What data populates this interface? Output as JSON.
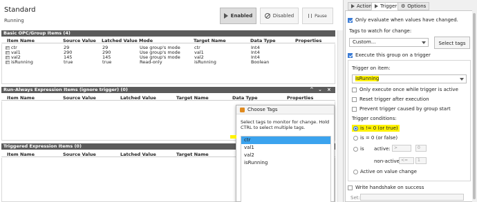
{
  "header": {
    "title": "Standard",
    "status": "Running",
    "enabled_label": "Enabled",
    "disabled_label": "Disabled",
    "pause_label": "Pause"
  },
  "columns": {
    "item_name": "Item Name",
    "source_value": "Source Value",
    "latched_value": "Latched Value",
    "mode": "Mode",
    "target_name": "Target Name",
    "data_type": "Data Type",
    "properties": "Properties"
  },
  "basic_section": {
    "title": "Basic OPC/Group Items (4)",
    "rows": [
      {
        "name": "ctr",
        "source": "29",
        "latched": "29",
        "mode": "Use group's mode",
        "target": "ctr",
        "type": "Int4"
      },
      {
        "name": "val1",
        "source": "290",
        "latched": "290",
        "mode": "Use group's mode",
        "target": "val1",
        "type": "Int4"
      },
      {
        "name": "val2",
        "source": "145",
        "latched": "145",
        "mode": "Use group's mode",
        "target": "val2",
        "type": "Int4"
      },
      {
        "name": "isRunning",
        "source": "true",
        "latched": "true",
        "mode": "Read-only",
        "target": "isRunning",
        "type": "Boolean"
      }
    ]
  },
  "run_always_section": {
    "title": "Run-Always Expression Items (ignore trigger) (0)"
  },
  "triggered_section": {
    "title": "Triggered Expression Items (0)"
  },
  "popup": {
    "title": "Choose Tags",
    "instructions": "Select tags to monitor for change. Hold CTRL to select multiple tags.",
    "items": [
      "ctr",
      "val1",
      "val2",
      "isRunning"
    ],
    "selected": "ctr"
  },
  "right_panel": {
    "tabs": [
      "Action",
      "Trigger",
      "Options"
    ],
    "active_tab": "Trigger",
    "only_evaluate_label": "Only evaluate when values have changed.",
    "tags_to_watch_label": "Tags to watch for change:",
    "tags_combo_value": "Custom...",
    "select_tags_label": "Select tags",
    "execute_on_trigger_label": "Execute this group on a trigger",
    "trigger_on_item_label": "Trigger on item:",
    "trigger_item_value": "isRunning",
    "only_once_label": "Only execute once while trigger is active",
    "reset_trigger_label": "Reset trigger after execution",
    "prevent_trigger_label": "Prevent trigger caused by group start",
    "trigger_conditions_label": "Trigger conditions:",
    "cond_nonzero_label": "is != 0 (or true)",
    "cond_zero_label": "is = 0 (or false)",
    "cond_is_label": "is",
    "active_label": "active:",
    "active_op": ">",
    "active_val": "0",
    "nonactive_label": "non-active:",
    "nonactive_op": "<=",
    "nonactive_val": "1",
    "active_on_change_label": "Active on value change",
    "write_handshake_label": "Write handshake on success",
    "set_label": "Set:"
  },
  "colors": {
    "section_header": "#5b5b5b",
    "highlight": "#fff200",
    "selection": "#3ba3ee",
    "checkbox": "#3a7bd5"
  }
}
